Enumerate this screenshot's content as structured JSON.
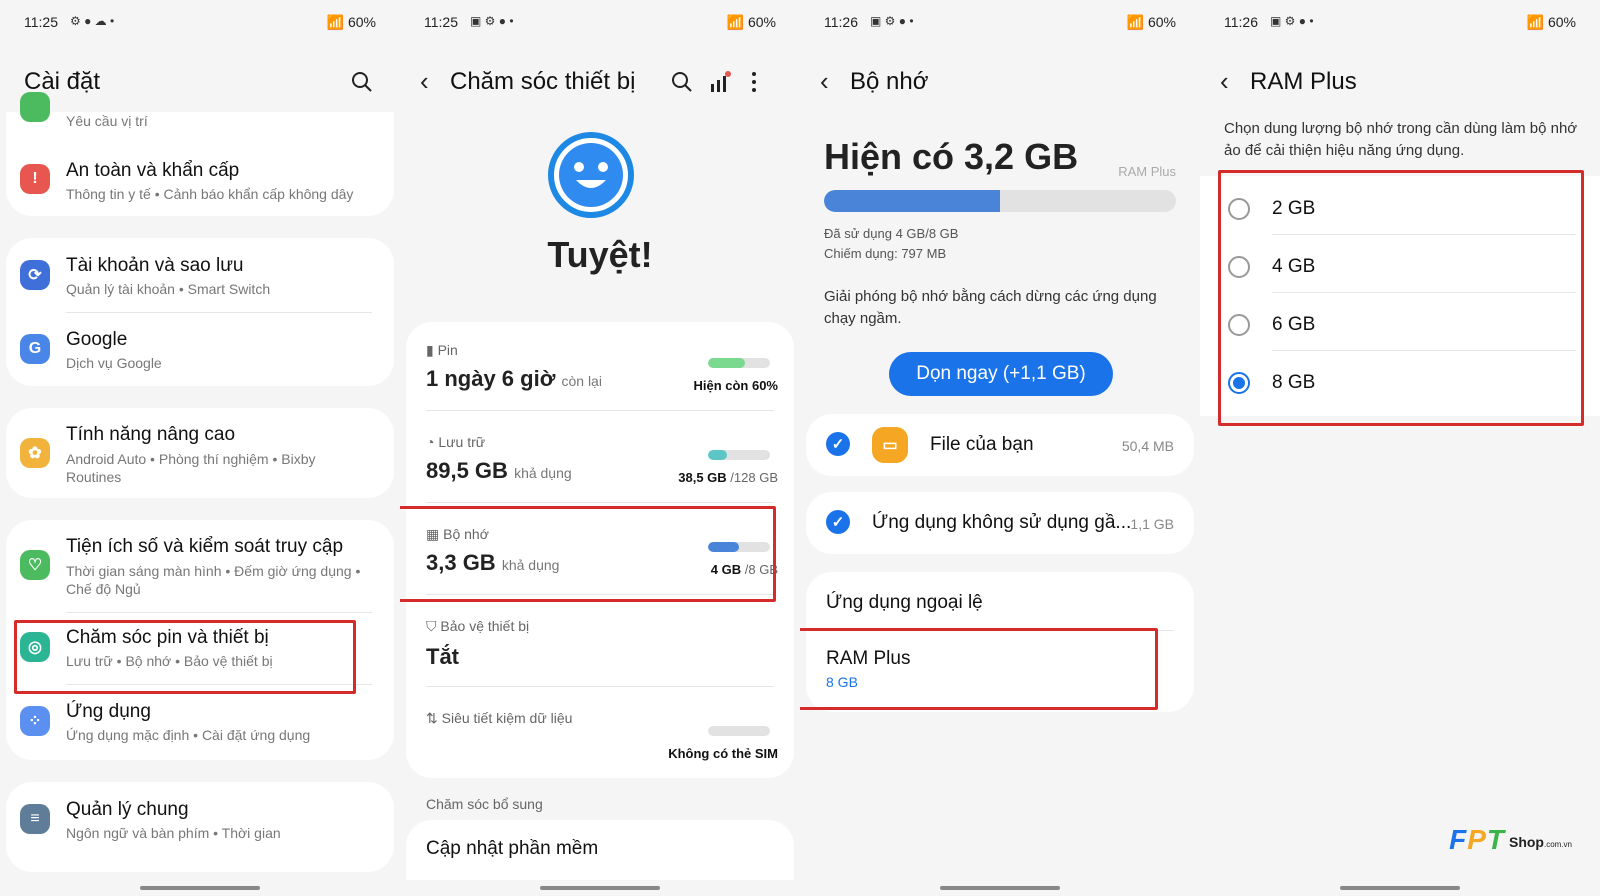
{
  "status": [
    {
      "time": "11:25",
      "battery": "60%"
    },
    {
      "time": "11:25",
      "battery": "60%"
    },
    {
      "time": "11:26",
      "battery": "60%"
    },
    {
      "time": "11:26",
      "battery": "60%"
    }
  ],
  "settings": {
    "title": "Cài đặt",
    "partial_sub": "Yêu cầu vị trí",
    "items": [
      {
        "title": "An toàn và khẩn cấp",
        "sub": "Thông tin y tế  •  Cảnh báo khẩn cấp không dây",
        "icon": "alert-icon",
        "color": "#e8574f"
      },
      {
        "title": "Tài khoản và sao lưu",
        "sub": "Quản lý tài khoản  •  Smart Switch",
        "icon": "sync-icon",
        "color": "#3f6fd8"
      },
      {
        "title": "Google",
        "sub": "Dịch vụ Google",
        "icon": "google-icon",
        "color": "#4a86e8"
      },
      {
        "title": "Tính năng nâng cao",
        "sub": "Android Auto  •  Phòng thí nghiệm  •  Bixby Routines",
        "icon": "gear-plus-icon",
        "color": "#f2b33d"
      },
      {
        "title": "Tiện ích số và kiểm soát truy cập",
        "sub": "Thời gian sáng màn hình  •  Đếm giờ ứng dụng  •  Chế độ Ngủ",
        "icon": "wellbeing-icon",
        "color": "#4cbb5f"
      },
      {
        "title": "Chăm sóc pin và thiết bị",
        "sub": "Lưu trữ  •  Bộ nhớ  •  Bảo vệ thiết bị",
        "icon": "device-care-icon",
        "color": "#2bb594"
      },
      {
        "title": "Ứng dụng",
        "sub": "Ứng dụng mặc định  •  Cài đặt ứng dụng",
        "icon": "apps-icon",
        "color": "#5b8ff0"
      },
      {
        "title": "Quản lý chung",
        "sub": "Ngôn ngữ và bàn phím  •  Thời gian",
        "icon": "sliders-icon",
        "color": "#5f7c99"
      }
    ]
  },
  "device_care": {
    "title": "Chăm sóc thiết bị",
    "status": "Tuyệt!",
    "battery": {
      "label": "Pin",
      "value": "1 ngày 6 giờ",
      "suffix": "còn lại",
      "right": "Hiện còn 60%",
      "fill": 0.6,
      "color": "#7bd88f"
    },
    "storage": {
      "label": "Lưu trữ",
      "value": "89,5 GB",
      "suffix": "khả dụng",
      "right_strong": "38,5 GB",
      "right_rest": " /128 GB",
      "fill": 0.3,
      "color": "#5cc6c6"
    },
    "memory": {
      "label": "Bộ nhớ",
      "value": "3,3 GB",
      "suffix": "khả dụng",
      "right_strong": "4 GB",
      "right_rest": " /8 GB",
      "fill": 0.5,
      "color": "#4a84d8"
    },
    "protection": {
      "label": "Bảo vệ thiết bị",
      "value": "Tắt"
    },
    "datasaver": {
      "label": "Siêu tiết kiệm dữ liệu",
      "right": "Không có thẻ SIM"
    },
    "extra_header": "Chăm sóc bổ sung",
    "update": "Cập nhật phần mềm"
  },
  "memory": {
    "title": "Bộ nhớ",
    "available": "Hiện có 3,2 GB",
    "ram_plus_tag": "RAM Plus",
    "fill": 0.5,
    "used": "Đã sử dụng 4 GB/8 GB",
    "occupied": "Chiếm dụng: 797 MB",
    "desc": "Giải phóng bộ nhớ bằng cách dừng các ứng dụng chạy ngầm.",
    "clean_button": "Dọn ngay (+1,1 GB)",
    "apps": [
      {
        "name": "File của bạn",
        "size": "50,4 MB"
      },
      {
        "name": "Ứng dụng không sử dụng gầ...",
        "size": "1,1 GB"
      }
    ],
    "exceptions": "Ứng dụng ngoại lệ",
    "ramplus_title": "RAM Plus",
    "ramplus_value": "8 GB"
  },
  "ram_plus": {
    "title": "RAM Plus",
    "desc": "Chọn dung lượng bộ nhớ trong cần dùng làm bộ nhớ ảo để cải thiện hiệu năng ứng dụng.",
    "options": [
      "2 GB",
      "4 GB",
      "6 GB",
      "8 GB"
    ],
    "selected": 3
  },
  "watermark": {
    "brand": "FPT",
    "text": "Shop",
    "suffix": ".com.vn"
  },
  "colors": {
    "accent": "#1a73e8",
    "highlight": "#d42b2b"
  }
}
